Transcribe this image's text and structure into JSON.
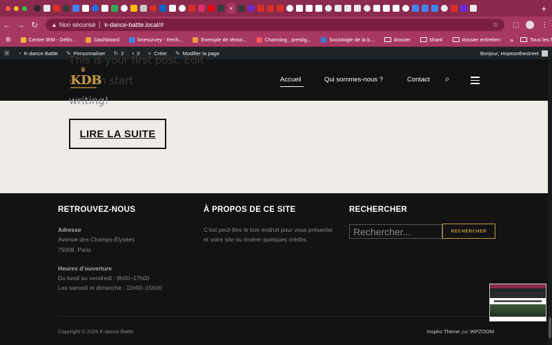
{
  "browser": {
    "address": {
      "security_label": "Non sécurisé",
      "url": "k-dance-battle.local/#"
    },
    "bookmarks": [
      {
        "label": "Centre IRM - Défin...",
        "color": "#f2b33d"
      },
      {
        "label": "Dashboard",
        "color": "#f2a33d"
      },
      {
        "label": "limesurvey - Rech...",
        "color": "#4285f4"
      },
      {
        "label": "Exemple de témoi...",
        "color": "#e8a040"
      },
      {
        "label": "Charming , prestig...",
        "color": "#ff5a5f"
      },
      {
        "label": "Sociologie de la b...",
        "color": "#3a7bd5"
      },
      {
        "label": "dossier",
        "color": "folder"
      },
      {
        "label": "bharti",
        "color": "folder"
      },
      {
        "label": "dossier entretien",
        "color": "folder"
      }
    ],
    "all_bookmarks_label": "Tous les favoris"
  },
  "adminbar": {
    "site_name": "K-dance Battle",
    "customize": "Personnaliser",
    "updates_count": "2",
    "comments_count": "0",
    "new_label": "Créer",
    "edit_label": "Modifier la page",
    "greeting": "Bonjour, Hopeonthestreet"
  },
  "header": {
    "logo_text": "KDB",
    "nav": [
      {
        "label": "Accueil"
      },
      {
        "label": "Qui sommes-nous ?"
      },
      {
        "label": "Contact"
      }
    ],
    "ghost_line1": "This is your first post. Edit",
    "ghost_line2": "it, then start"
  },
  "content": {
    "trailing_text": "writing!",
    "read_more": "LIRE LA SUITE"
  },
  "footer": {
    "col1": {
      "title": "RETROUVEZ-NOUS",
      "address_label": "Adresse",
      "address_line1": "Avenue des Champs-Élysées",
      "address_line2": "75008, Paris",
      "hours_label": "Heures d’ouverture",
      "hours_line1": "Du lundi au vendredi : 9h00–17h00",
      "hours_line2": "Les samedi et dimanche : 11h00–15h00"
    },
    "col2": {
      "title": "À PROPOS DE CE SITE",
      "line1": "C’est peut-être le bon endroit pour vous présenter",
      "line2": "et votre site ou insérer quelques crédits."
    },
    "col3": {
      "title": "RECHERCHER",
      "search_placeholder": "Rechercher...",
      "search_button": "RECHERCHER"
    },
    "copyright": "Copyright © 2025 K-dance Battle",
    "theme_name": "Inspiro Theme",
    "theme_by": "par",
    "theme_author": "WPZOOM"
  },
  "colors": {
    "chrome_tab": "#8b2a4e",
    "chrome_toolbar": "#a73763",
    "accent_gold": "#c69a45",
    "footer_bg": "#131313",
    "content_bg": "#efece8"
  }
}
